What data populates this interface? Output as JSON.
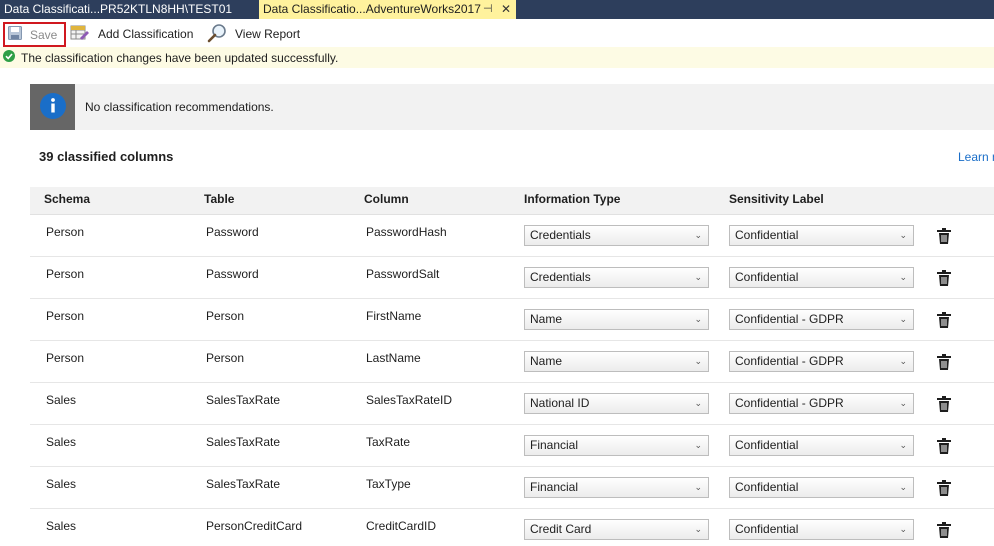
{
  "tabs": [
    {
      "label": "Data Classificati...PR52KTLN8HH\\TEST01",
      "active": false
    },
    {
      "label": "Data Classificatio...AdventureWorks2017",
      "active": true
    }
  ],
  "toolbar": {
    "save_label": "Save",
    "add_label": "Add Classification",
    "view_label": "View Report"
  },
  "status": {
    "message": "The classification changes have been updated successfully.",
    "color": "#2e9f46"
  },
  "recommendations": {
    "message": "No classification recommendations."
  },
  "summary": {
    "count_label": "39 classified columns",
    "learn_link": "Learn m"
  },
  "table": {
    "headers": [
      "Schema",
      "Table",
      "Column",
      "Information Type",
      "Sensitivity Label"
    ],
    "rows": [
      {
        "schema": "Person",
        "table": "Password",
        "column": "PasswordHash",
        "info_type": "Credentials",
        "label": "Confidential"
      },
      {
        "schema": "Person",
        "table": "Password",
        "column": "PasswordSalt",
        "info_type": "Credentials",
        "label": "Confidential"
      },
      {
        "schema": "Person",
        "table": "Person",
        "column": "FirstName",
        "info_type": "Name",
        "label": "Confidential - GDPR"
      },
      {
        "schema": "Person",
        "table": "Person",
        "column": "LastName",
        "info_type": "Name",
        "label": "Confidential - GDPR"
      },
      {
        "schema": "Sales",
        "table": "SalesTaxRate",
        "column": "SalesTaxRateID",
        "info_type": "National ID",
        "label": "Confidential - GDPR"
      },
      {
        "schema": "Sales",
        "table": "SalesTaxRate",
        "column": "TaxRate",
        "info_type": "Financial",
        "label": "Confidential"
      },
      {
        "schema": "Sales",
        "table": "SalesTaxRate",
        "column": "TaxType",
        "info_type": "Financial",
        "label": "Confidential"
      },
      {
        "schema": "Sales",
        "table": "PersonCreditCard",
        "column": "CreditCardID",
        "info_type": "Credit Card",
        "label": "Confidential"
      }
    ]
  },
  "icons": {
    "save": "floppy-disk-icon",
    "add": "add-classification-icon",
    "view": "magnifier-icon",
    "status": "check-circle-icon",
    "info": "info-icon",
    "delete": "trash-icon",
    "dropdown": "chevron-down-icon"
  },
  "colors": {
    "tabstrip": "#2d3e5c",
    "active_tab": "#fff29d",
    "save_highlight": "#d0181f",
    "info_icon": "#1a6ec8",
    "link": "#1a6ec8"
  }
}
